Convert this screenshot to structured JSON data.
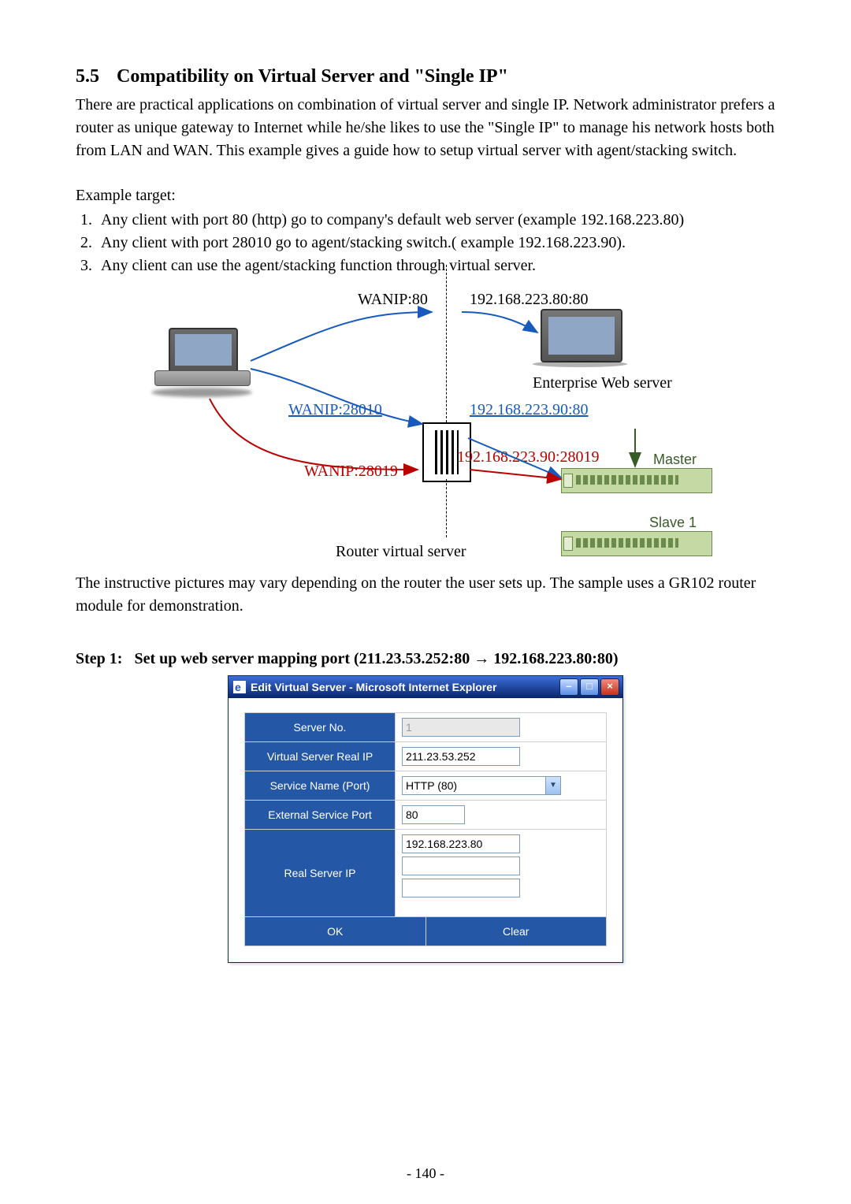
{
  "heading": {
    "num": "5.5",
    "title": "Compatibility on Virtual Server and \"Single IP\""
  },
  "para1": "There are practical applications on combination of virtual server and single IP. Network administrator prefers a router as unique gateway to Internet while he/she likes to use the \"Single IP\" to manage his network hosts both from LAN and WAN. This example gives a guide how to setup virtual server with agent/stacking switch.",
  "example_target_label": "Example target:",
  "bullets": [
    "Any client with port 80 (http) go to company's default web server (example 192.168.223.80)",
    "Any client with port 28010 go to agent/stacking switch.( example 192.168.223.90).",
    "Any client can use the agent/stacking function through virtual server."
  ],
  "diagram": {
    "wanip80": "WANIP:80",
    "target80": "192.168.223.80:80",
    "enterprise": "Enterprise Web server",
    "wanip28010": "WANIP:28010",
    "target_9080": "192.168.223.90:80",
    "wanip28019": "WANIP:28019",
    "target_9019": "192.168.223.90:28019",
    "master": "Master",
    "slave": "Slave 1",
    "router_caption": "Router virtual server"
  },
  "para2": "The instructive pictures may vary depending on the router the user sets up. The sample uses a GR102 router module for demonstration.",
  "step1": {
    "label": "Step 1:",
    "text": "Set up web server mapping port (211.23.53.252:80 → 192.168.223.80:80)"
  },
  "dialog": {
    "title": "Edit Virtual Server - Microsoft Internet Explorer",
    "rows": {
      "server_no_label": "Server No.",
      "server_no_value": "1",
      "vsr_label": "Virtual Server Real IP",
      "vsr_value": "211.23.53.252",
      "service_label": "Service Name (Port)",
      "service_value": "HTTP (80)",
      "ext_label": "External Service Port",
      "ext_value": "80",
      "real_label": "Real Server IP",
      "real_value": "192.168.223.80"
    },
    "ok": "OK",
    "clear": "Clear"
  },
  "page_number": "- 140 -"
}
